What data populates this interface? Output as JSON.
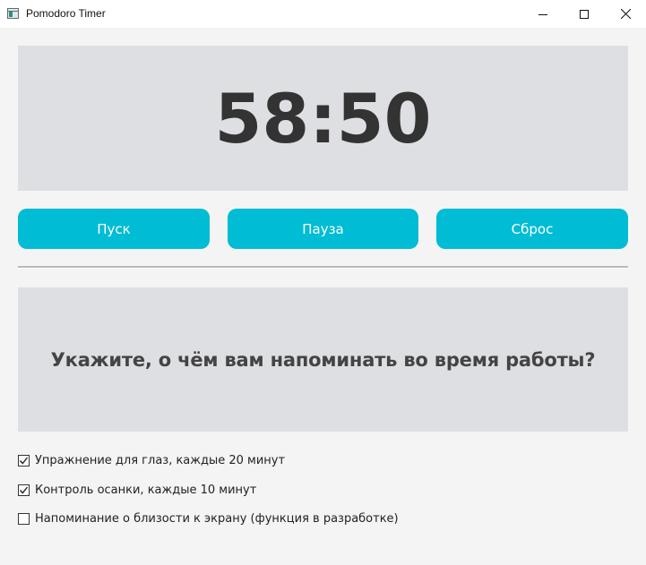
{
  "window": {
    "title": "Pomodoro Timer",
    "icon": "app-window-icon",
    "controls": [
      "minimize-icon",
      "maximize-icon",
      "close-icon"
    ]
  },
  "timer": {
    "display": "58:50"
  },
  "buttons": {
    "start": "Пуск",
    "pause": "Пауза",
    "reset": "Сброс"
  },
  "colors": {
    "accent": "#00bcd4",
    "panel": "#dedfe3",
    "background": "#f4f4f4",
    "timer_text": "#333333"
  },
  "reminders": {
    "heading": "Укажите, о чём вам напоминать во время работы?",
    "items": [
      {
        "label": "Упражнение для глаз, каждые 20 минут",
        "checked": true
      },
      {
        "label": "Контроль осанки, каждые 10 минут",
        "checked": true
      },
      {
        "label": "Напоминание о близости к экрану (функция в разработке)",
        "checked": false
      }
    ]
  }
}
